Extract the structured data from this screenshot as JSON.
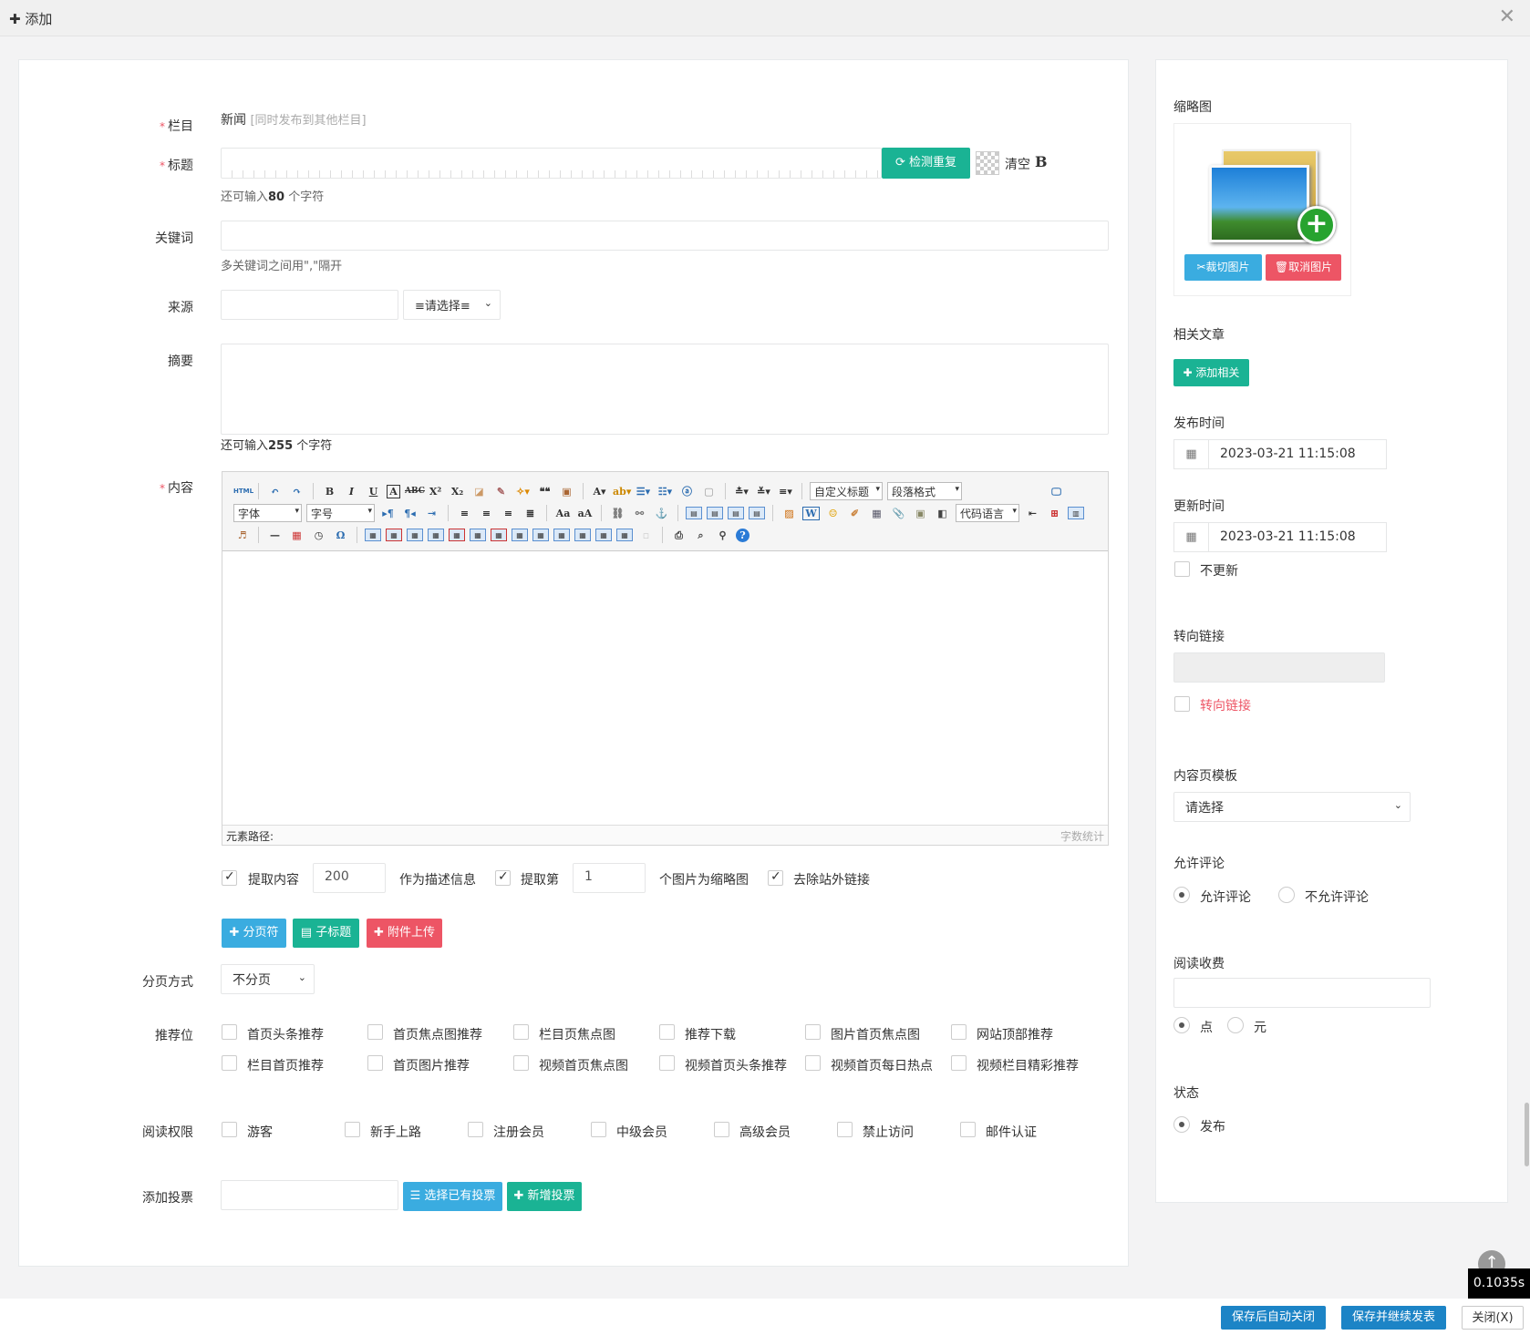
{
  "window": {
    "title": "添加",
    "close_glyph": "✕"
  },
  "form": {
    "category": {
      "label": "栏目",
      "value": "新闻",
      "extra": "[同时发布到其他栏目]"
    },
    "title": {
      "label": "标题",
      "check_btn": "检测重复",
      "clear": "清空",
      "bold": "B",
      "hint_prefix": "还可输入",
      "hint_count": "80",
      "hint_suffix": " 个字符"
    },
    "keywords": {
      "label": "关键词",
      "hint": "多关键词之间用\",\"隔开"
    },
    "source": {
      "label": "来源",
      "select": "≡请选择≡"
    },
    "summary": {
      "label": "摘要",
      "hint_prefix": "还可输入",
      "hint_count": "255",
      "hint_suffix": " 个字符"
    },
    "content": {
      "label": "内容",
      "toolbar": {
        "html": "HTML",
        "custom_title": "自定义标题",
        "paragraph": "段落格式",
        "font": "字体",
        "size": "字号",
        "code_lang": "代码语言"
      },
      "status_path": "元素路径:",
      "word_count": "字数统计"
    },
    "extract": {
      "extract_content": "提取内容",
      "desc_len": "200",
      "as_desc": "作为描述信息",
      "extract_nth": "提取第",
      "nth": "1",
      "as_thumb": "个图片为缩略图",
      "remove_links": "去除站外链接"
    },
    "buttons": {
      "page_break": "分页符",
      "subtitle": "子标题",
      "attach": "附件上传"
    },
    "paging": {
      "label": "分页方式",
      "value": "不分页"
    },
    "positions": {
      "label": "推荐位",
      "items": [
        "首页头条推荐",
        "首页焦点图推荐",
        "栏目页焦点图",
        "推荐下载",
        "图片首页焦点图",
        "网站顶部推荐",
        "栏目首页推荐",
        "首页图片推荐",
        "视频首页焦点图",
        "视频首页头条推荐",
        "视频首页每日热点",
        "视频栏目精彩推荐"
      ]
    },
    "permissions": {
      "label": "阅读权限",
      "items": [
        "游客",
        "新手上路",
        "注册会员",
        "中级会员",
        "高级会员",
        "禁止访问",
        "邮件认证"
      ]
    },
    "vote": {
      "label": "添加投票",
      "select_btn": "选择已有投票",
      "new_btn": "新增投票"
    }
  },
  "sidebar": {
    "thumb": {
      "label": "缩略图",
      "crop": "裁切图片",
      "cancel": "取消图片"
    },
    "related": {
      "label": "相关文章",
      "add": "添加相关"
    },
    "publish_time": {
      "label": "发布时间",
      "value": "2023-03-21 11:15:08"
    },
    "update_time": {
      "label": "更新时间",
      "value": "2023-03-21 11:15:08",
      "no_update": "不更新"
    },
    "redirect": {
      "label": "转向链接",
      "check": "转向链接"
    },
    "template": {
      "label": "内容页模板",
      "value": "请选择"
    },
    "comment": {
      "label": "允许评论",
      "allow": "允许评论",
      "deny": "不允许评论"
    },
    "fee": {
      "label": "阅读收费",
      "point": "点",
      "yuan": "元"
    },
    "status": {
      "label": "状态",
      "publish": "发布"
    }
  },
  "footer": {
    "save_close": "保存后自动关闭",
    "save_continue": "保存并继续发表",
    "close": "关闭(X)"
  },
  "timer": "0.1035s"
}
